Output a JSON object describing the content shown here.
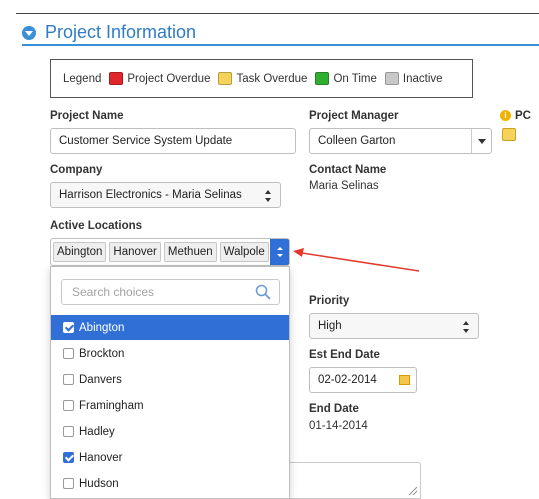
{
  "section": {
    "title": "Project Information"
  },
  "legend": {
    "label": "Legend",
    "items": [
      {
        "label": "Project Overdue",
        "color": "#e0262a"
      },
      {
        "label": "Task Overdue",
        "color": "#f5d25a"
      },
      {
        "label": "On Time",
        "color": "#2fae2f"
      },
      {
        "label": "Inactive",
        "color": "#c8c8c8"
      }
    ]
  },
  "fields": {
    "project_name": {
      "label": "Project Name",
      "value": "Customer Service System Update"
    },
    "project_manager": {
      "label": "Project Manager",
      "value": "Colleen Garton"
    },
    "pc": {
      "label": "PC"
    },
    "company": {
      "label": "Company",
      "value": "Harrison Electronics - Maria Selinas"
    },
    "contact_name": {
      "label": "Contact Name",
      "value": "Maria Selinas"
    },
    "active_locations": {
      "label": "Active Locations",
      "tags": [
        "Abington",
        "Hanover",
        "Methuen",
        "Walpole"
      ]
    },
    "priority": {
      "label": "Priority",
      "value": "High"
    },
    "est_end_date": {
      "label": "Est End Date",
      "value": "02-02-2014"
    },
    "end_date": {
      "label": "End Date",
      "value": "01-14-2014"
    }
  },
  "dropdown": {
    "search_placeholder": "Search choices",
    "options": [
      {
        "label": "Abington",
        "checked": true,
        "highlighted": true
      },
      {
        "label": "Brockton",
        "checked": false
      },
      {
        "label": "Danvers",
        "checked": false
      },
      {
        "label": "Framingham",
        "checked": false
      },
      {
        "label": "Hadley",
        "checked": false
      },
      {
        "label": "Hanover",
        "checked": true
      },
      {
        "label": "Hudson",
        "checked": false
      }
    ]
  },
  "accent_color": "#2f6fd6",
  "annotation_arrow_color": "#e23b2e"
}
